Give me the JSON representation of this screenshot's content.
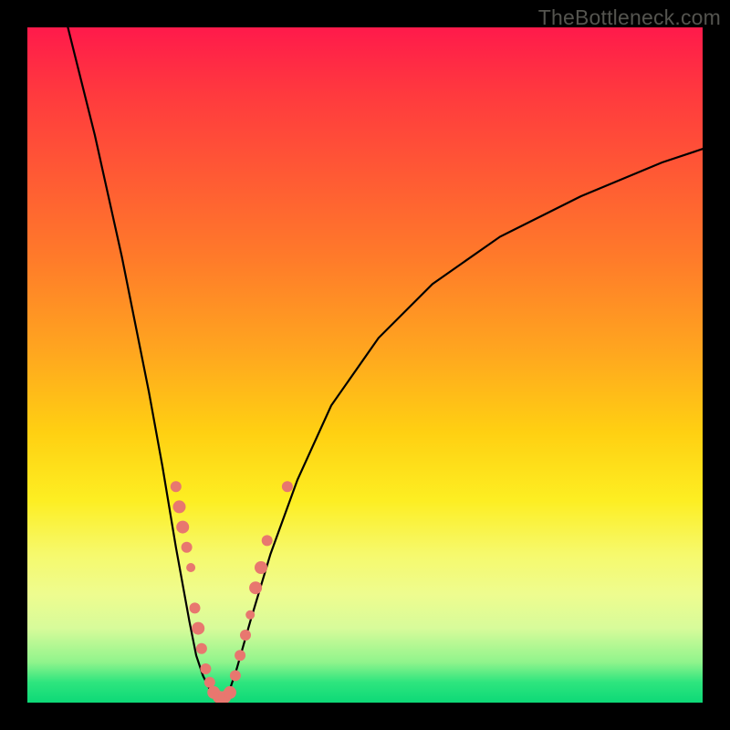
{
  "watermark": "TheBottleneck.com",
  "chart_data": {
    "type": "line",
    "title": "",
    "xlabel": "",
    "ylabel": "",
    "xlim": [
      0,
      100
    ],
    "ylim": [
      0,
      100
    ],
    "background_gradient": [
      {
        "pos": 0,
        "color": "#ff1a4b"
      },
      {
        "pos": 22,
        "color": "#ff5a34"
      },
      {
        "pos": 48,
        "color": "#ffa61f"
      },
      {
        "pos": 70,
        "color": "#fdee22"
      },
      {
        "pos": 89,
        "color": "#d7fb9a"
      },
      {
        "pos": 100,
        "color": "#0dd977"
      }
    ],
    "series": [
      {
        "name": "left-curve",
        "x": [
          6,
          8,
          10,
          12,
          14,
          16,
          18,
          20,
          22,
          24,
          25,
          26,
          27,
          28
        ],
        "y": [
          100,
          92,
          84,
          75,
          66,
          56,
          46,
          35,
          23,
          12,
          7,
          4,
          2,
          0
        ]
      },
      {
        "name": "right-curve",
        "x": [
          29,
          30,
          31,
          33,
          36,
          40,
          45,
          52,
          60,
          70,
          82,
          94,
          100
        ],
        "y": [
          0,
          2,
          5,
          12,
          22,
          33,
          44,
          54,
          62,
          69,
          75,
          80,
          82
        ]
      }
    ],
    "markers": [
      {
        "series": "left-curve",
        "x": 22.0,
        "y": 32,
        "r": 6
      },
      {
        "series": "left-curve",
        "x": 22.5,
        "y": 29,
        "r": 7
      },
      {
        "series": "left-curve",
        "x": 23.0,
        "y": 26,
        "r": 7
      },
      {
        "series": "left-curve",
        "x": 23.6,
        "y": 23,
        "r": 6
      },
      {
        "series": "left-curve",
        "x": 24.2,
        "y": 20,
        "r": 5
      },
      {
        "series": "left-curve",
        "x": 24.8,
        "y": 14,
        "r": 6
      },
      {
        "series": "left-curve",
        "x": 25.3,
        "y": 11,
        "r": 7
      },
      {
        "series": "left-curve",
        "x": 25.8,
        "y": 8,
        "r": 6
      },
      {
        "series": "left-curve",
        "x": 26.4,
        "y": 5,
        "r": 6
      },
      {
        "series": "left-curve",
        "x": 27.0,
        "y": 3,
        "r": 6
      },
      {
        "series": "bottom",
        "x": 27.6,
        "y": 1.5,
        "r": 7
      },
      {
        "series": "bottom",
        "x": 28.4,
        "y": 0.8,
        "r": 7
      },
      {
        "series": "bottom",
        "x": 29.2,
        "y": 0.8,
        "r": 7
      },
      {
        "series": "bottom",
        "x": 30.0,
        "y": 1.5,
        "r": 7
      },
      {
        "series": "right-curve",
        "x": 30.8,
        "y": 4,
        "r": 6
      },
      {
        "series": "right-curve",
        "x": 31.5,
        "y": 7,
        "r": 6
      },
      {
        "series": "right-curve",
        "x": 32.3,
        "y": 10,
        "r": 6
      },
      {
        "series": "right-curve",
        "x": 33.0,
        "y": 13,
        "r": 5
      },
      {
        "series": "right-curve",
        "x": 33.8,
        "y": 17,
        "r": 7
      },
      {
        "series": "right-curve",
        "x": 34.6,
        "y": 20,
        "r": 7
      },
      {
        "series": "right-curve",
        "x": 35.5,
        "y": 24,
        "r": 6
      },
      {
        "series": "right-curve",
        "x": 38.5,
        "y": 32,
        "r": 6
      }
    ]
  }
}
